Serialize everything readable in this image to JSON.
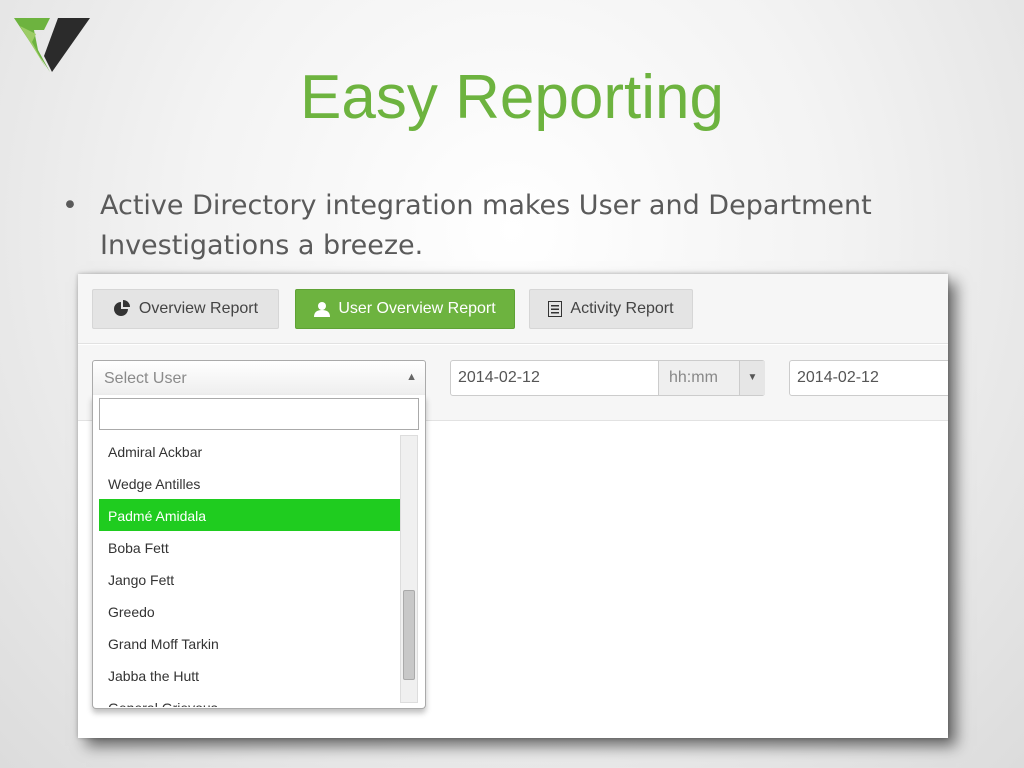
{
  "slide": {
    "title": "Easy Reporting",
    "bullet_marker": "•",
    "bullet_text": "Active Directory integration makes User and Department Investigations a breeze."
  },
  "colors": {
    "accent": "#6db33f",
    "selected_option": "#1fcc1f",
    "logo_dark": "#2b2b2b"
  },
  "tabs": [
    {
      "label": "Overview Report",
      "icon": "pie-chart-icon",
      "active": false
    },
    {
      "label": "User Overview Report",
      "icon": "user-icon",
      "active": true
    },
    {
      "label": "Activity Report",
      "icon": "list-icon",
      "active": false
    }
  ],
  "filters": {
    "user_select_placeholder": "Select User",
    "start_date": "2014-02-12",
    "time_placeholder": "hh:mm",
    "end_date": "2014-02-12"
  },
  "dropdown": {
    "search_value": "",
    "options": [
      "Admiral Ackbar",
      "Wedge Antilles",
      "Padmé Amidala",
      "Boba Fett",
      "Jango Fett",
      "Greedo",
      "Grand Moff Tarkin",
      "Jabba the Hutt",
      "General Grievous"
    ],
    "selected": "Padmé Amidala"
  }
}
